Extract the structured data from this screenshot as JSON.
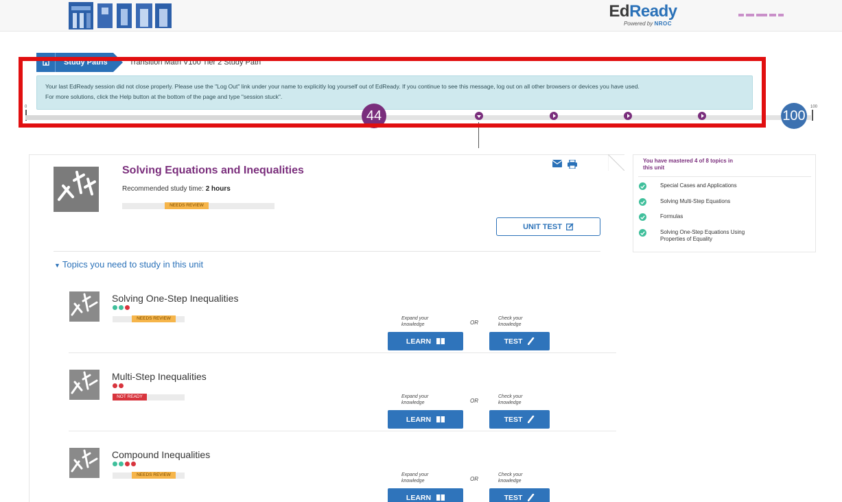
{
  "header": {
    "brand_main_ed": "Ed",
    "brand_main_ready": "Ready",
    "powered_by": "Powered by",
    "powered_org": "NROC"
  },
  "breadcrumb": {
    "study_paths": "Study Paths",
    "current_path": "Transition Math V100 Tier 2 Study Path"
  },
  "alert": {
    "line1": "Your last EdReady session did not close properly. Please use the \"Log Out\" link under your name to explicitly log yourself out of EdReady. If you continue to see this message, log out on all other browsers or devices you have used.",
    "line2": "For more solutions, click the Help button at the bottom of the page and type \"session stuck\"."
  },
  "scale": {
    "min_label": "0",
    "max_label": "100",
    "current_score": "44",
    "target_score": "100",
    "current_fraction": 0.44
  },
  "unit": {
    "title": "Solving Equations and Inequalities",
    "study_time_label": "Recommended study time: ",
    "study_time_value": "2 hours",
    "status": "NEEDS REVIEW",
    "unit_test_label": "UNIT TEST",
    "topics_heading": "Topics you need to study in this unit"
  },
  "topics": [
    {
      "title": "Solving One-Step Inequalities",
      "dots": [
        "g",
        "g",
        "r"
      ],
      "status": "NEEDS REVIEW",
      "status_type": "review"
    },
    {
      "title": "Multi-Step Inequalities",
      "dots": [
        "r",
        "r"
      ],
      "status": "NOT READY",
      "status_type": "notready"
    },
    {
      "title": "Compound Inequalities",
      "dots": [
        "g",
        "g",
        "r",
        "r"
      ],
      "status": "NEEDS REVIEW",
      "status_type": "review"
    }
  ],
  "topic_actions": {
    "expand_label": "Expand your knowledge",
    "check_label": "Check your knowledge",
    "or_label": "OR",
    "learn_label": "LEARN",
    "test_label": "TEST"
  },
  "sidebar": {
    "heading": "You have mastered 4 of 8 topics in this unit",
    "items": [
      "Special Cases and Applications",
      "Solving Multi-Step Equations",
      "Formulas",
      "Solving One-Step Equations Using Properties of Equality"
    ]
  },
  "colors": {
    "brand_blue": "#2a71b8",
    "brand_purple": "#7a2e7c",
    "review": "#f6b54a",
    "not_ready": "#d8343d",
    "mastered": "#3fbf9b",
    "highlight": "#e10f10"
  }
}
